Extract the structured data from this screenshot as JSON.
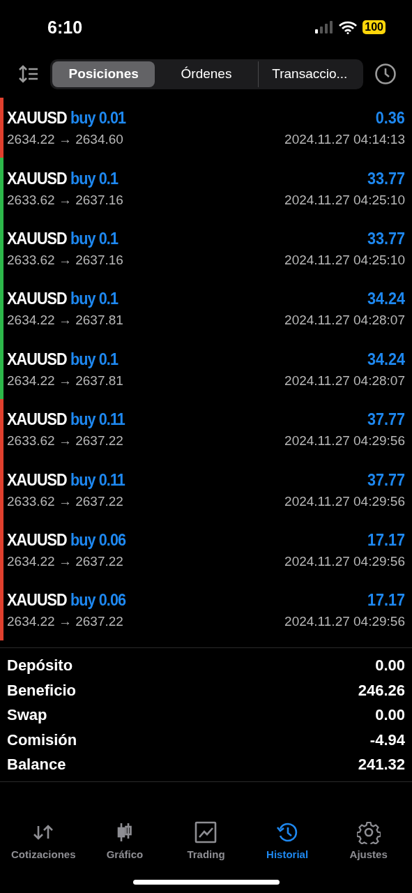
{
  "status_bar": {
    "time": "6:10",
    "battery": "100"
  },
  "toolbar": {
    "tabs": [
      {
        "label": "Posiciones",
        "selected": true
      },
      {
        "label": "Órdenes",
        "selected": false
      },
      {
        "label": "Transaccio...",
        "selected": false
      }
    ]
  },
  "deals": [
    {
      "symbol": "XAUUSD",
      "side": "buy 0.01",
      "prices": "2634.22 → 2634.60",
      "profit": "0.36",
      "time": "2024.11.27 04:14:13",
      "color": "#e0402e"
    },
    {
      "symbol": "XAUUSD",
      "side": "buy 0.1",
      "prices": "2633.62 → 2637.16",
      "profit": "33.77",
      "time": "2024.11.27 04:25:10",
      "color": "#2db84a"
    },
    {
      "symbol": "XAUUSD",
      "side": "buy 0.1",
      "prices": "2633.62 → 2637.16",
      "profit": "33.77",
      "time": "2024.11.27 04:25:10",
      "color": "#2db84a"
    },
    {
      "symbol": "XAUUSD",
      "side": "buy 0.1",
      "prices": "2634.22 → 2637.81",
      "profit": "34.24",
      "time": "2024.11.27 04:28:07",
      "color": "#2db84a"
    },
    {
      "symbol": "XAUUSD",
      "side": "buy 0.1",
      "prices": "2634.22 → 2637.81",
      "profit": "34.24",
      "time": "2024.11.27 04:28:07",
      "color": "#2db84a"
    },
    {
      "symbol": "XAUUSD",
      "side": "buy 0.11",
      "prices": "2633.62 → 2637.22",
      "profit": "37.77",
      "time": "2024.11.27 04:29:56",
      "color": "#e0402e"
    },
    {
      "symbol": "XAUUSD",
      "side": "buy 0.11",
      "prices": "2633.62 → 2637.22",
      "profit": "37.77",
      "time": "2024.11.27 04:29:56",
      "color": "#e0402e"
    },
    {
      "symbol": "XAUUSD",
      "side": "buy 0.06",
      "prices": "2634.22 → 2637.22",
      "profit": "17.17",
      "time": "2024.11.27 04:29:56",
      "color": "#e0402e"
    },
    {
      "symbol": "XAUUSD",
      "side": "buy 0.06",
      "prices": "2634.22 → 2637.22",
      "profit": "17.17",
      "time": "2024.11.27 04:29:56",
      "color": "#e0402e"
    }
  ],
  "summary": [
    {
      "label": "Depósito",
      "value": "0.00"
    },
    {
      "label": "Beneficio",
      "value": "246.26"
    },
    {
      "label": "Swap",
      "value": "0.00"
    },
    {
      "label": "Comisión",
      "value": "-4.94"
    },
    {
      "label": "Balance",
      "value": "241.32"
    }
  ],
  "tab_bar": [
    {
      "label": "Cotizaciones",
      "kind": "quotes",
      "selected": false
    },
    {
      "label": "Gráfico",
      "kind": "chart",
      "selected": false
    },
    {
      "label": "Trading",
      "kind": "trading",
      "selected": false
    },
    {
      "label": "Historial",
      "kind": "history",
      "selected": true
    },
    {
      "label": "Ajustes",
      "kind": "settings",
      "selected": false
    }
  ]
}
